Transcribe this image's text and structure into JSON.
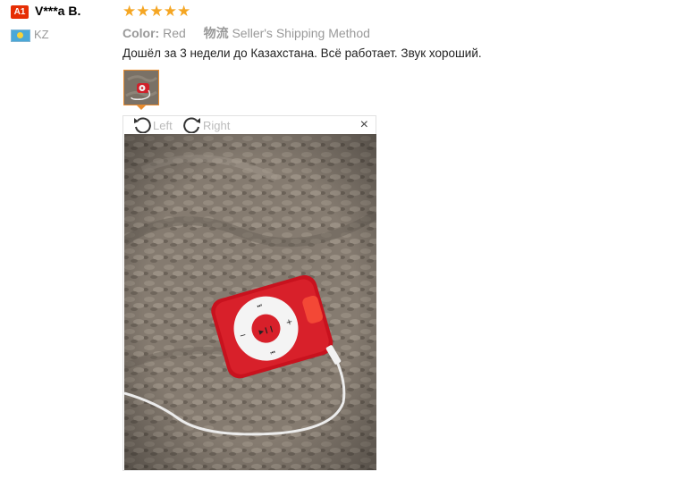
{
  "reviewer": {
    "badge": "A1",
    "name": "V***a B.",
    "country": "KZ"
  },
  "rating": {
    "stars": "★★★★★",
    "value": 5,
    "max": 5
  },
  "attributes": {
    "color_label": "Color:",
    "color_value": "Red",
    "shipping_label": "物流",
    "shipping_value": "Seller's Shipping Method"
  },
  "review_text": "Дошёл за 3 недели до Казахстана. Всё работает. Звук хороший.",
  "viewer": {
    "rotate_left": "Left",
    "rotate_right": "Right",
    "close": "×"
  },
  "colors": {
    "badge": "#e62e04",
    "stars": "#f5a623",
    "thumb_border": "#e88b2e",
    "player": "#d8202a"
  },
  "icons": [
    "rotate-left-icon",
    "rotate-right-icon",
    "close-icon",
    "star-icon",
    "kz-flag-icon"
  ]
}
